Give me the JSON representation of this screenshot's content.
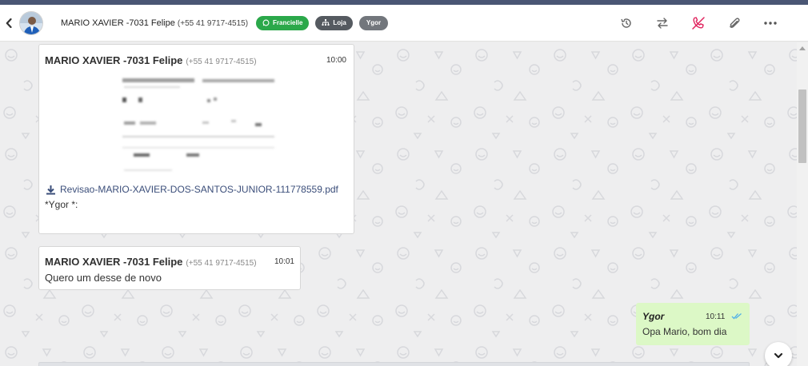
{
  "header": {
    "contact_name": "MARIO XAVIER -7031 Felipe",
    "contact_phone": "(+55 41 9717-4515)",
    "tags": [
      "Francielle",
      "Loja",
      "Ygor"
    ],
    "icons": [
      "back-chevron-icon",
      "history-icon",
      "transfer-icon",
      "end-call-icon",
      "attachment-icon",
      "more-icon"
    ]
  },
  "messages": [
    {
      "sender": "MARIO XAVIER -7031 Felipe",
      "phone": "(+55 41 9717-4515)",
      "time": "10:00",
      "file_name": "Revisao-MARIO-XAVIER-DOS-SANTOS-JUNIOR-111778559.pdf",
      "caption": "*Ygor *:"
    },
    {
      "sender": "MARIO XAVIER -7031 Felipe",
      "phone": "(+55 41 9717-4515)",
      "time": "10:01",
      "text": "Quero um desse de novo"
    },
    {
      "sender": "Ygor",
      "time": "10:11",
      "text": "Opa Mario, bom dia",
      "status": "read-double-check"
    }
  ],
  "colors": {
    "top_stripe": "#4a5674",
    "tag_whatsapp": "#2ba84a",
    "tag_store": "#555a60",
    "tag_agent": "#72767c",
    "outgoing_bubble": "#dcf8c6",
    "end_call_icon": "#e0245e",
    "read_tick": "#4fb0e8"
  }
}
